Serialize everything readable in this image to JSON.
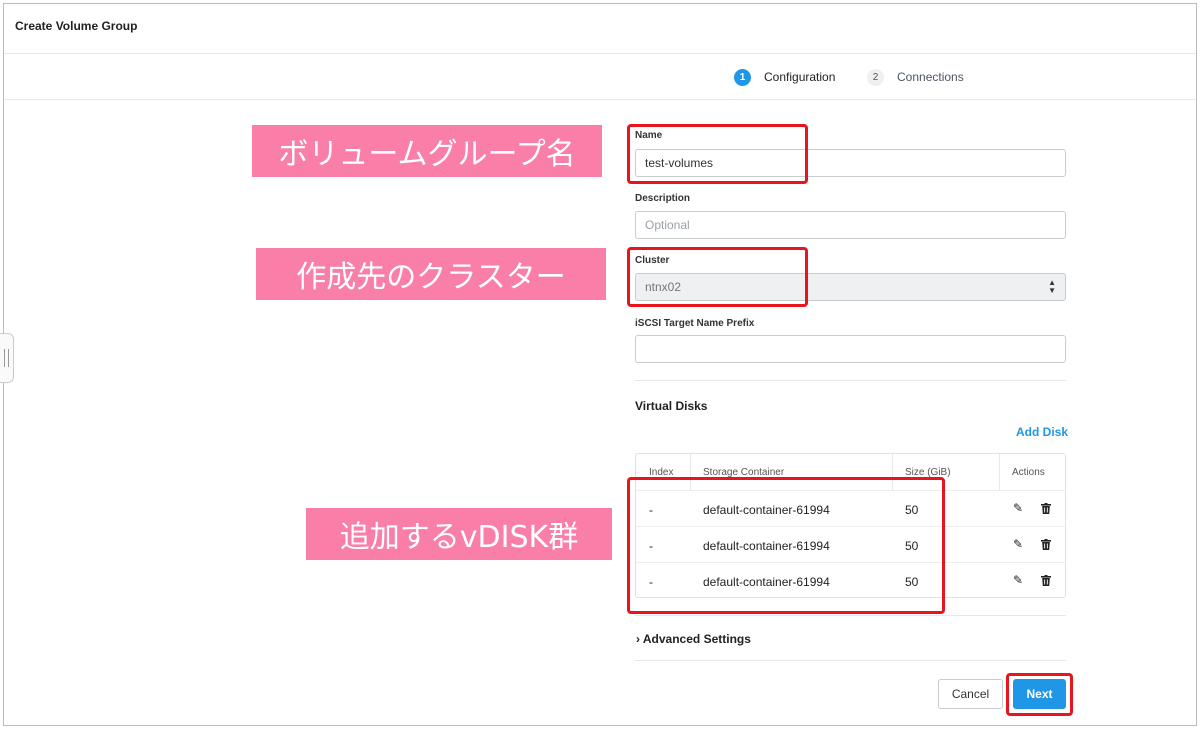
{
  "window": {
    "title": "Create Volume Group"
  },
  "steps": [
    {
      "number": "1",
      "label": "Configuration",
      "active": true
    },
    {
      "number": "2",
      "label": "Connections",
      "active": false
    }
  ],
  "form": {
    "name": {
      "label": "Name",
      "value": "test-volumes"
    },
    "description": {
      "label": "Description",
      "placeholder": "Optional"
    },
    "cluster": {
      "label": "Cluster",
      "value": "ntnx02"
    },
    "iscsi_prefix": {
      "label": "iSCSI Target Name Prefix",
      "value": ""
    }
  },
  "virtual_disks": {
    "title": "Virtual Disks",
    "add_label": "Add Disk",
    "columns": [
      "Index",
      "Storage Container",
      "Size (GiB)",
      "Actions"
    ],
    "rows": [
      {
        "index": "-",
        "container": "default-container-61994",
        "size": "50"
      },
      {
        "index": "-",
        "container": "default-container-61994",
        "size": "50"
      },
      {
        "index": "-",
        "container": "default-container-61994",
        "size": "50"
      }
    ]
  },
  "advanced": {
    "label": "› Advanced Settings"
  },
  "footer": {
    "cancel_label": "Cancel",
    "next_label": "Next"
  },
  "annotations": {
    "volume_group_name": "ボリュームグループ名",
    "target_cluster": "作成先のクラスター",
    "vdisks_to_add": "追加するvDISK群"
  },
  "colors": {
    "accent": "#2097e6",
    "annotation_bg": "#f97fa8",
    "highlight": "#e8151e"
  },
  "icons": {
    "edit": "pencil-icon",
    "delete": "trash-icon"
  }
}
